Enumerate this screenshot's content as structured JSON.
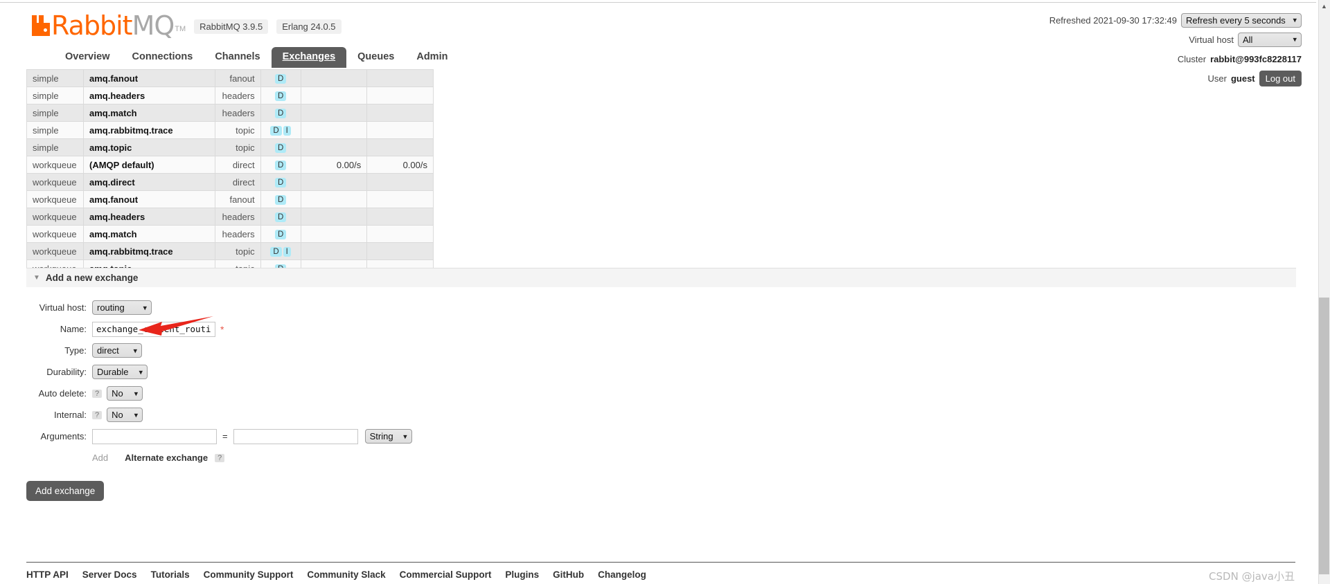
{
  "header": {
    "logo_rabbit": "Rabbit",
    "logo_mq": "MQ",
    "logo_tm": "TM",
    "version_rabbitmq": "RabbitMQ 3.9.5",
    "version_erlang": "Erlang 24.0.5",
    "refreshed_label": "Refreshed 2021-09-30 17:32:49",
    "refresh_select_value": "Refresh every 5 seconds",
    "refresh_options": [
      "Refresh every 5 seconds"
    ],
    "vhost_label": "Virtual host",
    "vhost_select_value": "All",
    "vhost_options": [
      "All"
    ],
    "cluster_label": "Cluster",
    "cluster_name": "rabbit@993fc8228117",
    "user_label": "User",
    "user_name": "guest",
    "logout_label": "Log out"
  },
  "nav": {
    "tabs": [
      {
        "label": "Overview",
        "active": false
      },
      {
        "label": "Connections",
        "active": false
      },
      {
        "label": "Channels",
        "active": false
      },
      {
        "label": "Exchanges",
        "active": true
      },
      {
        "label": "Queues",
        "active": false
      },
      {
        "label": "Admin",
        "active": false
      }
    ]
  },
  "exchange_table": {
    "rows": [
      {
        "vhost": "simple",
        "name": "amq.fanout",
        "type": "fanout",
        "features": [
          "D"
        ],
        "rate_in": "",
        "rate_out": ""
      },
      {
        "vhost": "simple",
        "name": "amq.headers",
        "type": "headers",
        "features": [
          "D"
        ],
        "rate_in": "",
        "rate_out": ""
      },
      {
        "vhost": "simple",
        "name": "amq.match",
        "type": "headers",
        "features": [
          "D"
        ],
        "rate_in": "",
        "rate_out": ""
      },
      {
        "vhost": "simple",
        "name": "amq.rabbitmq.trace",
        "type": "topic",
        "features": [
          "D",
          "I"
        ],
        "rate_in": "",
        "rate_out": ""
      },
      {
        "vhost": "simple",
        "name": "amq.topic",
        "type": "topic",
        "features": [
          "D"
        ],
        "rate_in": "",
        "rate_out": ""
      },
      {
        "vhost": "workqueue",
        "name": "(AMQP default)",
        "type": "direct",
        "features": [
          "D"
        ],
        "rate_in": "0.00/s",
        "rate_out": "0.00/s"
      },
      {
        "vhost": "workqueue",
        "name": "amq.direct",
        "type": "direct",
        "features": [
          "D"
        ],
        "rate_in": "",
        "rate_out": ""
      },
      {
        "vhost": "workqueue",
        "name": "amq.fanout",
        "type": "fanout",
        "features": [
          "D"
        ],
        "rate_in": "",
        "rate_out": ""
      },
      {
        "vhost": "workqueue",
        "name": "amq.headers",
        "type": "headers",
        "features": [
          "D"
        ],
        "rate_in": "",
        "rate_out": ""
      },
      {
        "vhost": "workqueue",
        "name": "amq.match",
        "type": "headers",
        "features": [
          "D"
        ],
        "rate_in": "",
        "rate_out": ""
      },
      {
        "vhost": "workqueue",
        "name": "amq.rabbitmq.trace",
        "type": "topic",
        "features": [
          "D",
          "I"
        ],
        "rate_in": "",
        "rate_out": ""
      },
      {
        "vhost": "workqueue",
        "name": "amq.topic",
        "type": "topic",
        "features": [
          "D"
        ],
        "rate_in": "",
        "rate_out": ""
      }
    ]
  },
  "add_exchange_form": {
    "section_title": "Add a new exchange",
    "vhost_label": "Virtual host:",
    "vhost_value": "routing",
    "vhost_options": [
      "routing"
    ],
    "name_label": "Name:",
    "name_value": "exchange_content_routing",
    "name_required_marker": "*",
    "type_label": "Type:",
    "type_value": "direct",
    "type_options": [
      "direct"
    ],
    "durability_label": "Durability:",
    "durability_value": "Durable",
    "durability_options": [
      "Durable"
    ],
    "auto_delete_label": "Auto delete:",
    "auto_delete_help": "?",
    "auto_delete_value": "No",
    "auto_delete_options": [
      "No"
    ],
    "internal_label": "Internal:",
    "internal_help": "?",
    "internal_value": "No",
    "internal_options": [
      "No"
    ],
    "arguments_label": "Arguments:",
    "argument_key_value": "",
    "argument_key_placeholder": "",
    "argument_val_value": "",
    "argument_val_placeholder": "",
    "equals_sign": "=",
    "argument_type_value": "String",
    "argument_type_options": [
      "String"
    ],
    "add_link_label": "Add",
    "alternate_exchange_label": "Alternate exchange",
    "alternate_exchange_help": "?",
    "submit_label": "Add exchange"
  },
  "footer": {
    "links": [
      "HTTP API",
      "Server Docs",
      "Tutorials",
      "Community Support",
      "Community Slack",
      "Commercial Support",
      "Plugins",
      "GitHub",
      "Changelog"
    ]
  },
  "watermark": {
    "text": "CSDN @java小丑"
  },
  "colors": {
    "brand_orange": "#ff6600",
    "tab_active_bg": "#5c5c5c",
    "feature_badge_bg": "#aeeaf7",
    "required_marker": "#e8574a",
    "annotation_arrow": "#e8251b"
  }
}
